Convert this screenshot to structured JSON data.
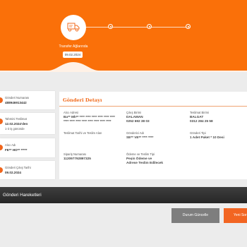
{
  "tracking": {
    "current_stage": "Transfer Ağlarında",
    "current_date": "09.02.2024"
  },
  "summary": [
    {
      "label": "Gönderi Numarası",
      "value": "488946913442",
      "sub": "",
      "icon": "barcode-icon"
    },
    {
      "label": "Tahmini Teslimat",
      "value": "12.02.2024'den",
      "sub": "1-3 iş gününde",
      "icon": "calendar-icon"
    },
    {
      "label": "Alıcı Adı",
      "value": "FE** HO** *****",
      "sub": "",
      "icon": "user-icon"
    },
    {
      "label": "Gönderi Çıkış Tarihi",
      "value": "09.02.2024",
      "sub": "",
      "icon": "calendar-icon"
    }
  ],
  "details": {
    "title": "Gönderi Detayı",
    "fields": [
      {
        "label": "Alıcı Adresi",
        "value": "Ba** Mh** **** **** **** **** **** **** **** **** **** **** **** **** **** ****"
      },
      {
        "label": "Çıkış Birimi",
        "value": "DALAMAN\n0252 692 38 03"
      },
      {
        "label": "Teslimat Birimi",
        "value": "BALGAT\n0312 284 25 58"
      },
      {
        "label": "Teslimat Tarihi ve Teslim Alan",
        "value": ""
      },
      {
        "label": "Gönderici Adı",
        "value": "SE** VE** **** ****"
      },
      {
        "label": "Gönderi Tipi",
        "value": "1 Adet Paket * 10 Desi"
      },
      {
        "label": "Sipariş Numarası",
        "value": "112097792897325"
      },
      {
        "label": "Ödeme ve Teslim Tipi",
        "value": "Peşin Ödeme ve\nAdrese Teslim Edilecek"
      }
    ]
  },
  "movements_title": "Gönderi Hareketleri",
  "buttons": {
    "update": "Durum Güncelle",
    "new": "Yeni Sor"
  },
  "colors": {
    "brand_orange": "#fa7009",
    "dark_bar": "#333333",
    "button_gray": "#7e7e7e"
  }
}
